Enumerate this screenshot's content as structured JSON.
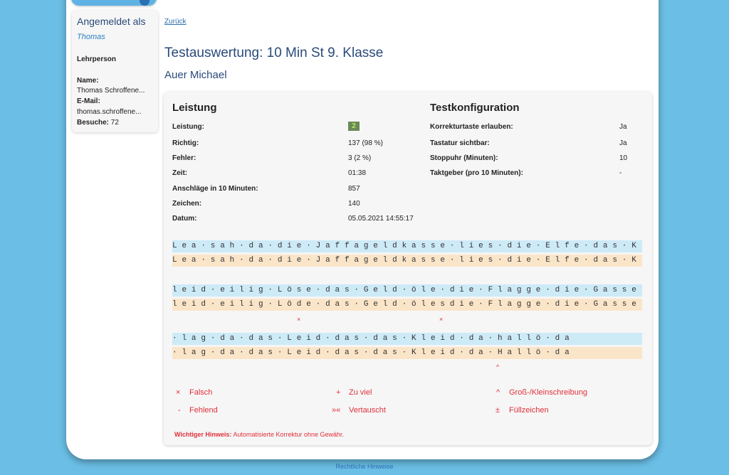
{
  "sidebar": {
    "title": "Angemeldet als",
    "user": "Thomas",
    "role": "Lehrperson",
    "name_label": "Name:",
    "name_value": "Thomas Schroffene...",
    "email_label": "E-Mail:",
    "email_value": "thomas.schroffene...",
    "visits_label": "Besuche:",
    "visits_value": "72"
  },
  "back_link": "Zurück",
  "title": "Testauswertung: 10 Min St 9. Klasse",
  "student": "Auer Michael",
  "performance": {
    "title": "Leistung",
    "rows": [
      {
        "label": "Leistung:",
        "value": "2"
      },
      {
        "label": "Richtig:",
        "value": "137 (98 %)"
      },
      {
        "label": "Fehler:",
        "value": "3 (2 %)"
      },
      {
        "label": "Zeit:",
        "value": "01:38"
      },
      {
        "label": "Anschläge in 10 Minuten:",
        "value": "857"
      },
      {
        "label": "Zeichen:",
        "value": "140"
      },
      {
        "label": "Datum:",
        "value": "05.05.2021 14:55:17"
      }
    ],
    "grade_color": "#6a8a54"
  },
  "config": {
    "title": "Testkonfiguration",
    "rows": [
      {
        "label": "Korrekturtaste erlauben:",
        "value": "Ja"
      },
      {
        "label": "Tastatur sichtbar:",
        "value": "Ja"
      },
      {
        "label": "Stoppuhr (Minuten):",
        "value": "10"
      },
      {
        "label": "Taktgeber (pro 10 Minuten):",
        "value": "-"
      }
    ]
  },
  "text_blocks": [
    {
      "expected": "L e a · s a h · d a · d i e · J a f f a g e l d k a s s e · l i e s · d i e · E l f e · d a s · K",
      "typed": "L e a · s a h · d a · d i e · J a f f a g e l d k a s s e · l i e s · d i e · E l f e · d a s · K",
      "marks": []
    },
    {
      "expected": "l e i d · e i l i g · L ö s e · d a s · G e l d · ö l e · d i e · F l a g g e · d i e · G a s s e",
      "typed": "l e i d · e i l i g · L ö d e · d a s · G e l d · ö l e s d i e · F l a g g e · d i e · G a s s e",
      "marks": [
        "×",
        "×"
      ]
    },
    {
      "expected": "· l a g · d a · d a s · L e i d · d a s · d a s · K l e i d · d a · h a l l ö · d a",
      "typed": "· l a g · d a · d a s · L e i d · d a s · d a s · K l e i d · d a · H a l l ö · d a",
      "marks": [
        "^"
      ]
    }
  ],
  "legend": [
    {
      "symbol": "×",
      "label": "Falsch"
    },
    {
      "symbol": "+",
      "label": "Zu viel"
    },
    {
      "symbol": "^",
      "label": "Groß-/Kleinschreibung"
    },
    {
      "symbol": "-",
      "label": "Fehlend"
    },
    {
      "symbol": "»«",
      "label": "Vertauscht"
    },
    {
      "symbol": "±",
      "label": "Füllzeichen"
    }
  ],
  "notice": {
    "bold": "Wichtiger Hinweis:",
    "text": " Automatisierte Korrektur ohne Gewähr."
  },
  "footer": "Rechtliche Hinweise",
  "colors": {
    "background": "#6bbfe6",
    "accent": "#2a4a7a",
    "error": "#e0303a",
    "expected_bg": "#cdeaf7",
    "typed_bg": "#fbe5c9"
  }
}
